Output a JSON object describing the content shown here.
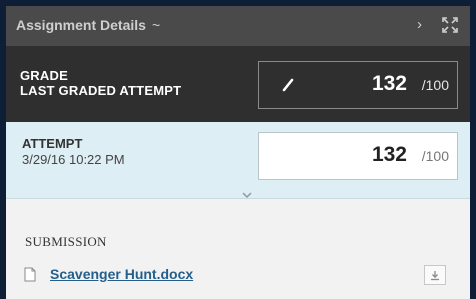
{
  "header": {
    "title": "Assignment Details",
    "caret": "~",
    "next_icon": "chevron-right-icon",
    "expand_icon": "fullscreen-icon"
  },
  "grade": {
    "label_line1": "GRADE",
    "label_line2": "LAST GRADED ATTEMPT",
    "score": "132",
    "max": "/100",
    "edit_icon": "pencil-icon"
  },
  "attempt": {
    "label": "ATTEMPT",
    "date": "3/29/16 10:22 PM",
    "score": "132",
    "max": "/100",
    "expand_icon": "chevron-down-icon"
  },
  "submission": {
    "heading": "SUBMISSION",
    "file_name": "Scavenger Hunt.docx",
    "file_icon": "document-icon",
    "download_icon": "download-icon"
  },
  "colors": {
    "header_bg": "#4a4a4a",
    "grade_bg": "#2f2f2f",
    "attempt_bg": "#ddeef4",
    "link": "#245f8c",
    "frame": "#0d1e36"
  }
}
